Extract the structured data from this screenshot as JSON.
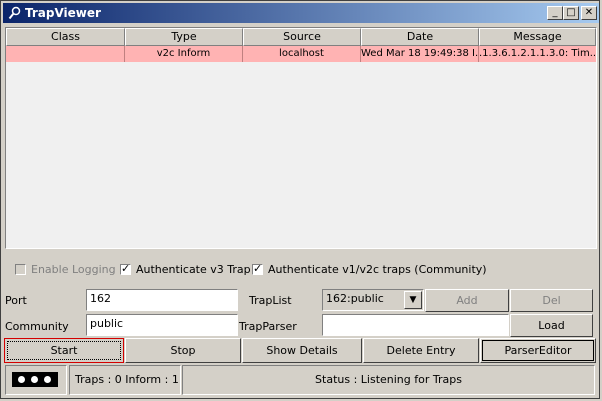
{
  "window": {
    "title": "TrapViewer",
    "minimize": "_",
    "maximize": "□",
    "close": "✕"
  },
  "table": {
    "columns": [
      "Class",
      "Type",
      "Source",
      "Date",
      "Message"
    ],
    "rows": [
      {
        "class": "",
        "type": "v2c Inform",
        "source": "localhost",
        "date": "Wed Mar 18 19:49:38 I...",
        "message": ".1.3.6.1.2.1.1.3.0:  Tim..."
      }
    ],
    "row_color": "#ffb3b3"
  },
  "options": {
    "enable_logging": {
      "label": "Enable Logging",
      "checked": false,
      "enabled": false
    },
    "auth_v3": {
      "label": "Authenticate v3 Trap",
      "checked": true
    },
    "auth_v1v2c": {
      "label": "Authenticate v1/v2c traps (Community)",
      "checked": true
    }
  },
  "form": {
    "port_label": "Port",
    "port_value": "162",
    "community_label": "Community",
    "community_value": "public",
    "traplist_label": "TrapList",
    "traplist_value": "162:public",
    "trapparser_label": "TrapParser",
    "trapparser_value": "",
    "add_label": "Add",
    "del_label": "Del",
    "load_label": "Load"
  },
  "actions": {
    "start": "Start",
    "stop": "Stop",
    "show_details": "Show Details",
    "delete_entry": "Delete Entry",
    "parser_editor": "ParserEditor"
  },
  "status": {
    "counts": "Traps :  0 Inform :  1",
    "message": "Status : Listening for Traps"
  },
  "icons": {
    "title": "trapviewer-icon",
    "combo": "dropdown-arrow-icon",
    "anim": "activity-dots-icon"
  }
}
